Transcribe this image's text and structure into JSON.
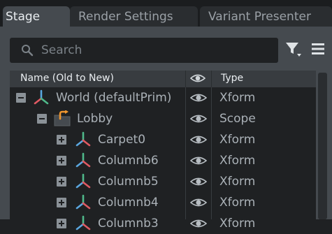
{
  "tabs": [
    {
      "label": "Stage",
      "active": true
    },
    {
      "label": "Render Settings",
      "active": false
    },
    {
      "label": "Variant Presenter",
      "active": false
    }
  ],
  "search": {
    "placeholder": "Search",
    "value": ""
  },
  "toolbar": {
    "filter_icon": "filter-icon",
    "menu_icon": "hamburger-menu-icon"
  },
  "columns": {
    "name": "Name (Old to New)",
    "visibility_icon": "eye-icon",
    "type": "Type"
  },
  "rows": [
    {
      "label": "World (defaultPrim)",
      "type": "Xform",
      "expander": "collapse",
      "icon": "xform-axis-icon",
      "visible": true
    },
    {
      "label": "Lobby",
      "type": "Scope",
      "expander": "collapse",
      "icon": "scope-folder-icon",
      "visible": true
    },
    {
      "label": "Carpet0",
      "type": "Xform",
      "expander": "expand",
      "icon": "xform-axis-icon",
      "visible": true
    },
    {
      "label": "Columnb6",
      "type": "Xform",
      "expander": "expand",
      "icon": "xform-axis-icon",
      "visible": true
    },
    {
      "label": "Columnb5",
      "type": "Xform",
      "expander": "expand",
      "icon": "xform-axis-icon",
      "visible": true
    },
    {
      "label": "Columnb4",
      "type": "Xform",
      "expander": "expand",
      "icon": "xform-axis-icon",
      "visible": true
    },
    {
      "label": "Columnb3",
      "type": "Xform",
      "expander": "expand",
      "icon": "xform-axis-icon",
      "visible": true
    }
  ],
  "colors": {
    "background": "#1f2123",
    "panel": "#454a4f",
    "header": "#383c40",
    "text": "#aab1b7",
    "axis_red": "#e05a63",
    "axis_green": "#4fb98a",
    "axis_blue": "#5aa7e0",
    "folder_orange": "#f0962e"
  }
}
